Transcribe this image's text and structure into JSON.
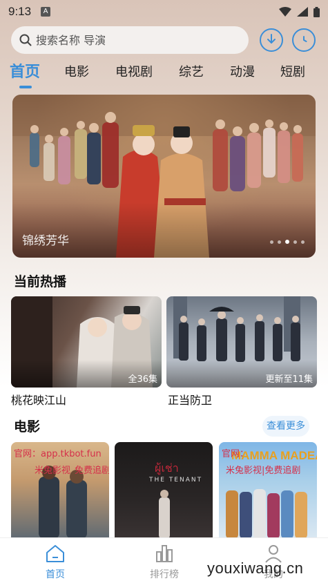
{
  "status_bar": {
    "time": "9:13",
    "notification_letter": "A"
  },
  "search": {
    "placeholder": "搜索名称 导演"
  },
  "tabs": [
    "首页",
    "电影",
    "电视剧",
    "综艺",
    "动漫",
    "短剧"
  ],
  "banner": {
    "title": "锦绣芳华",
    "slide_count": 5,
    "active_slide": 3
  },
  "now_playing": {
    "title": "当前热播",
    "items": [
      {
        "name": "桃花映江山",
        "badge": "全36集"
      },
      {
        "name": "正当防卫",
        "badge": "更新至11集"
      }
    ]
  },
  "movies": {
    "title": "电影",
    "more_label": "查看更多",
    "posters": [
      {
        "line1": "官网：app.tkbot.fun",
        "line2": "米兔影视",
        "line3": "免费追剧"
      },
      {
        "line1": "ผู้เช่า",
        "line2": "THE TENANT"
      },
      {
        "line1": "MAMMA MADEA",
        "line2": "官网：",
        "line3": "米兔影视|免费追剧"
      }
    ]
  },
  "bottom_nav": [
    {
      "label": "首页",
      "icon": "home-icon",
      "active": true
    },
    {
      "label": "排行榜",
      "icon": "ranking-icon",
      "active": false
    },
    {
      "label": "我的",
      "icon": "profile-icon",
      "active": false
    }
  ],
  "watermark": "youxiwang.cn",
  "colors": {
    "accent": "#3a8ed8",
    "poster_text": "#d5304a"
  }
}
